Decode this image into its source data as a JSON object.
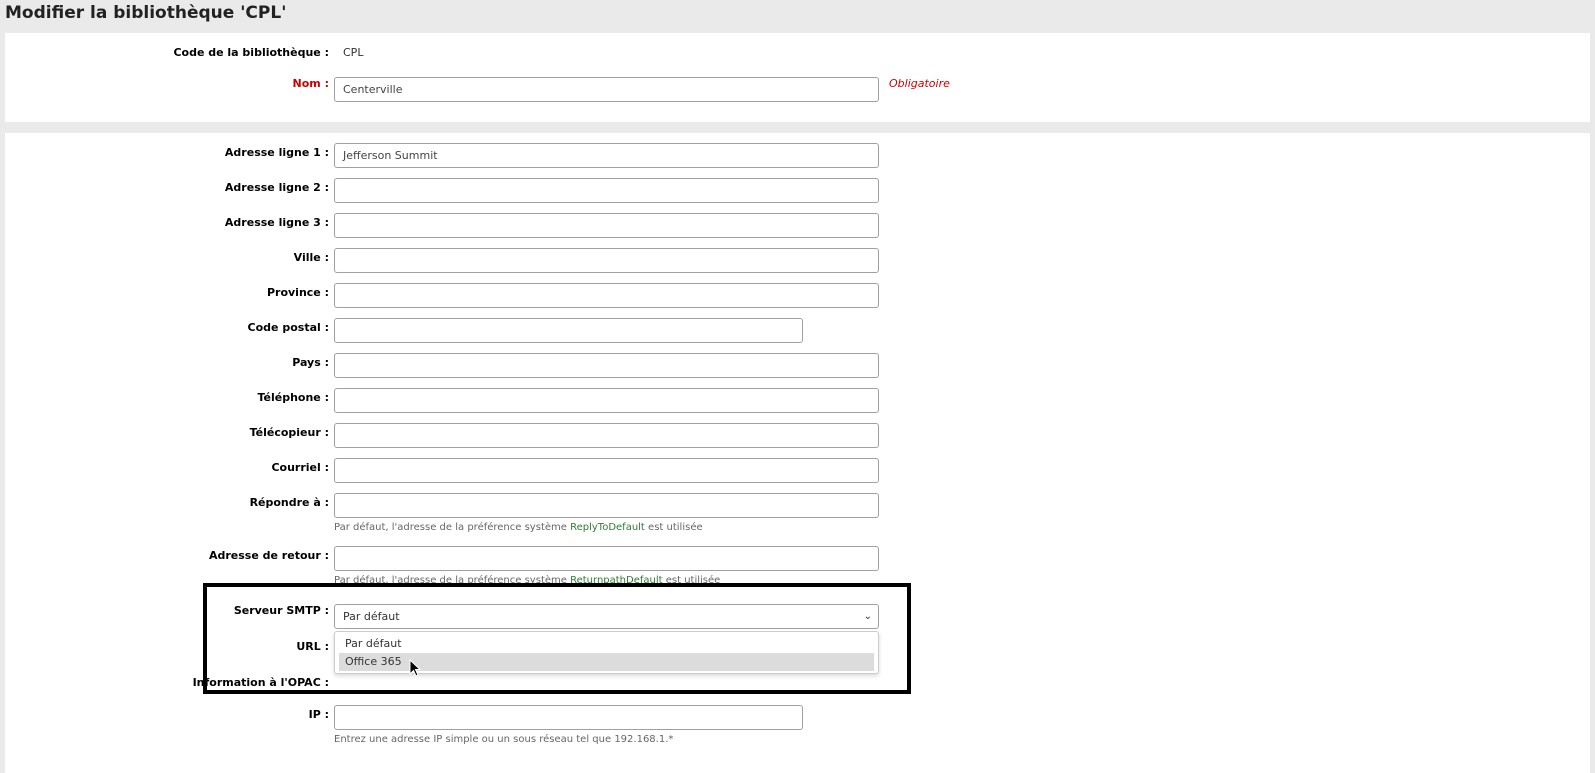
{
  "page": {
    "title": "Modifier la bibliothèque 'CPL'"
  },
  "identity": {
    "code_label": "Code de la bibliothèque :",
    "code_value": "CPL",
    "name_label": "Nom :",
    "name_value": "Centerville",
    "required_note": "Obligatoire"
  },
  "address": {
    "line1_label": "Adresse ligne 1 :",
    "line1_value": "Jefferson Summit",
    "line2_label": "Adresse ligne 2 :",
    "line2_value": "",
    "line3_label": "Adresse ligne 3 :",
    "line3_value": "",
    "city_label": "Ville :",
    "city_value": "",
    "province_label": "Province :",
    "province_value": "",
    "postal_label": "Code postal :",
    "postal_value": "",
    "country_label": "Pays :",
    "country_value": "",
    "phone_label": "Téléphone :",
    "phone_value": "",
    "fax_label": "Télécopieur :",
    "fax_value": "",
    "email_label": "Courriel :",
    "email_value": "",
    "replyto_label": "Répondre à :",
    "replyto_value": "",
    "replyto_hint_before": "Par défaut, l'adresse de la préférence système",
    "replyto_hint_pref": "ReplyToDefault",
    "replyto_hint_after": "est utilisée",
    "return_label": "Adresse de retour :",
    "return_value": "",
    "return_hint_before": "Par défaut, l'adresse de la préférence système",
    "return_hint_pref": "ReturnpathDefault",
    "return_hint_after": "est utilisée"
  },
  "smtp": {
    "label": "Serveur SMTP :",
    "selected": "Par défaut",
    "options": [
      "Par défaut",
      "Office 365"
    ]
  },
  "url": {
    "label": "URL :"
  },
  "opac": {
    "label": "Information à l'OPAC :"
  },
  "ip": {
    "label": "IP :",
    "value": "",
    "hint": "Entrez une adresse IP simple ou un sous réseau tel que 192.168.1.*"
  },
  "colors": {
    "required": "#cc0000",
    "pref_link": "#2e7d32",
    "highlight": "#dcdcdc"
  }
}
